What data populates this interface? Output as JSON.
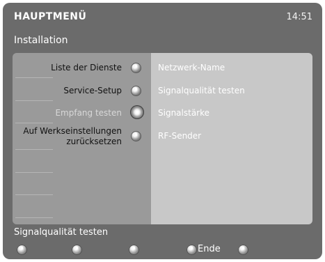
{
  "header": {
    "title": "HAUPTMENÜ",
    "time": "14:51"
  },
  "screen": {
    "section_title": "Installation"
  },
  "left_menu": {
    "items": [
      {
        "label": "Liste der Dienste"
      },
      {
        "label": "Service-Setup"
      },
      {
        "label": "Empfang testen"
      },
      {
        "label": "Auf Werkseinstellungen zurücksetzen"
      }
    ]
  },
  "right_menu": {
    "items": [
      {
        "label": "Netzwerk-Name"
      },
      {
        "label": "Signalqualität testen"
      },
      {
        "label": "Signalstärke"
      },
      {
        "label": "RF-Sender"
      }
    ]
  },
  "footer": {
    "status": "Signalqualität testen",
    "ende_label": "Ende"
  },
  "colors": {
    "screen_bg": "#6b6b6b",
    "left_pane_bg": "#9a9a9a",
    "right_pane_bg": "#c8c8c8",
    "text_primary": "#111111",
    "text_secondary": "#ffffff"
  },
  "icons": {
    "menu_knob": "knob-icon",
    "footer_button": "button-icon"
  }
}
